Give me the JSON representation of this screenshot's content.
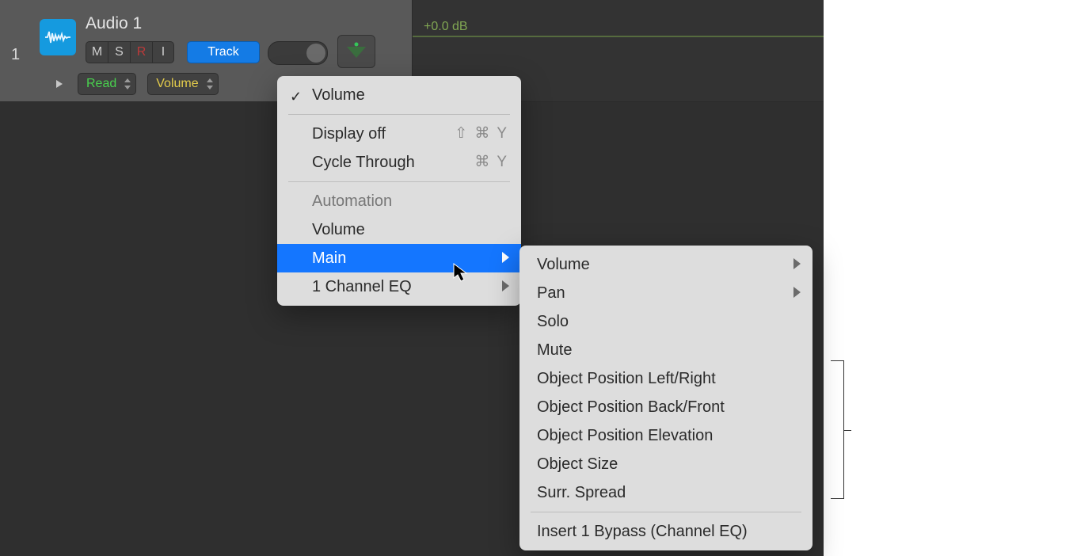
{
  "track": {
    "number": "1",
    "name": "Audio 1",
    "buttons": {
      "m": "M",
      "s": "S",
      "r": "R",
      "i": "I"
    },
    "track_button": "Track",
    "automation_mode": "Read",
    "automation_param": "Volume"
  },
  "lane": {
    "db_label": "+0.0 dB"
  },
  "menu": {
    "checked_label": "Volume",
    "display_off": "Display off",
    "display_off_shortcut": "⇧ ⌘ Y",
    "cycle_through": "Cycle Through",
    "cycle_through_shortcut": "⌘ Y",
    "section_header": "Automation",
    "volume": "Volume",
    "main": "Main",
    "channel_eq": "1 Channel EQ"
  },
  "submenu": {
    "volume": "Volume",
    "pan": "Pan",
    "solo": "Solo",
    "mute": "Mute",
    "obj_lr": "Object Position Left/Right",
    "obj_bf": "Object Position Back/Front",
    "obj_el": "Object Position Elevation",
    "obj_size": "Object Size",
    "surr_spread": "Surr. Spread",
    "insert_bypass": "Insert 1 Bypass (Channel EQ)"
  }
}
